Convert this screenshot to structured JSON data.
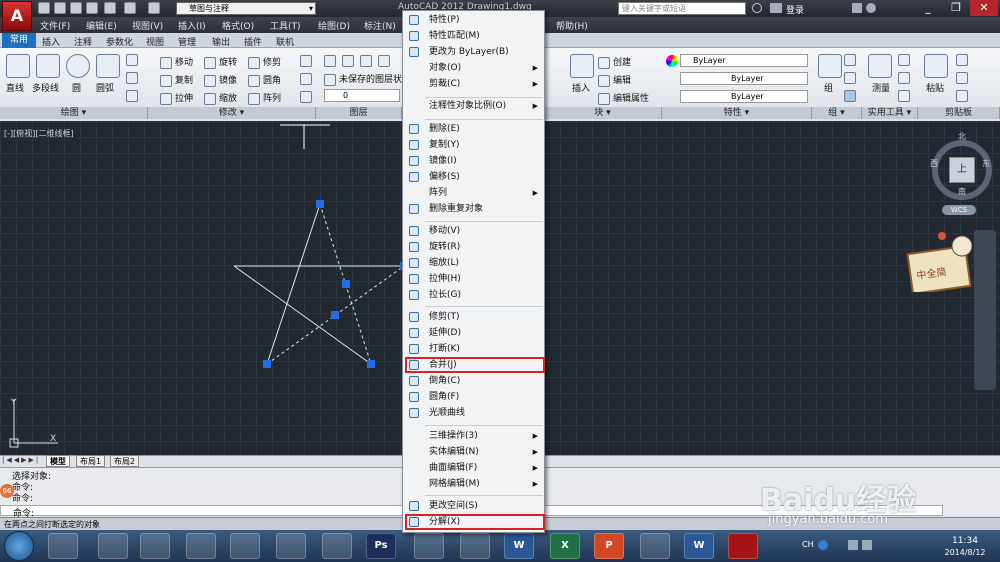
{
  "titlebar": {
    "workspace": "草图与注释",
    "app_title": "AutoCAD 2012    Drawing1.dwg",
    "search_placeholder": "键入关键字或短语",
    "login": "登录",
    "logo_letter": "A"
  },
  "menubar": [
    "文件(F)",
    "编辑(E)",
    "视图(V)",
    "插入(I)",
    "格式(O)",
    "工具(T)",
    "绘图(D)",
    "标注(N)",
    "帮助(H)"
  ],
  "ribbon_tabs": [
    "常用",
    "插入",
    "注释",
    "参数化",
    "视图",
    "管理",
    "输出",
    "插件",
    "联机"
  ],
  "ribbon": {
    "draw": {
      "line": "直线",
      "polyline": "多段线",
      "circle": "圆",
      "arc": "圆弧",
      "title": "绘图 ▾"
    },
    "modify": {
      "move": "移动",
      "rotate": "旋转",
      "trim": "修剪",
      "copy": "复制",
      "mirror": "镜像",
      "fillet": "圆角",
      "stretch": "拉伸",
      "scale": "缩放",
      "array": "阵列",
      "title": "修改 ▾"
    },
    "layers": {
      "state": "未保存的图层状态",
      "layer_value": "0",
      "title": "图层"
    },
    "block": {
      "insert": "插入",
      "create": "创建",
      "edit": "编辑",
      "edit_attr": "编辑属性",
      "title": "块 ▾"
    },
    "properties": {
      "color": "ByLayer",
      "linetype": "ByLayer",
      "lineweight": "ByLayer",
      "title": "特性 ▾"
    },
    "group": {
      "label": "组",
      "title": "组 ▾"
    },
    "utilities": {
      "measure": "测量",
      "title": "实用工具 ▾"
    },
    "clipboard": {
      "paste": "粘贴",
      "title": "剪贴板"
    }
  },
  "viewport_label": "[-][俯视][二维线框]",
  "viewcube": {
    "top": "上",
    "north": "北",
    "south": "南",
    "east": "东",
    "west": "西",
    "wcs": "WCS"
  },
  "layout_tabs": [
    "模型",
    "布局1",
    "布局2"
  ],
  "command": {
    "lines": [
      "选择对象:",
      "命令:",
      "命令:"
    ],
    "prompt": "命令:",
    "badge": "66"
  },
  "status_text": "在两点之间打断选定的对象",
  "context_menu": {
    "items": [
      {
        "label": "特性(P)",
        "arrow": false
      },
      {
        "label": "特性匹配(M)",
        "arrow": false
      },
      {
        "label": "更改为 ByLayer(B)",
        "arrow": false
      },
      {
        "label": "对象(O)",
        "arrow": true
      },
      {
        "label": "剪裁(C)",
        "arrow": true
      },
      {
        "label": "注释性对象比例(O)",
        "arrow": true
      },
      {
        "label": "删除(E)",
        "arrow": false
      },
      {
        "label": "复制(Y)",
        "arrow": false
      },
      {
        "label": "镜像(I)",
        "arrow": false
      },
      {
        "label": "偏移(S)",
        "arrow": false
      },
      {
        "label": "阵列",
        "arrow": true
      },
      {
        "label": "删除重复对象",
        "arrow": false
      },
      {
        "label": "移动(V)",
        "arrow": false
      },
      {
        "label": "旋转(R)",
        "arrow": false
      },
      {
        "label": "缩放(L)",
        "arrow": false
      },
      {
        "label": "拉伸(H)",
        "arrow": false
      },
      {
        "label": "拉长(G)",
        "arrow": false
      },
      {
        "label": "修剪(T)",
        "arrow": false
      },
      {
        "label": "延伸(D)",
        "arrow": false
      },
      {
        "label": "打断(K)",
        "arrow": false
      },
      {
        "label": "合并(J)",
        "arrow": false
      },
      {
        "label": "倒角(C)",
        "arrow": false
      },
      {
        "label": "圆角(F)",
        "arrow": false
      },
      {
        "label": "光顺曲线",
        "arrow": false
      },
      {
        "label": "三维操作(3)",
        "arrow": true
      },
      {
        "label": "实体编辑(N)",
        "arrow": true
      },
      {
        "label": "曲面编辑(F)",
        "arrow": true
      },
      {
        "label": "网格编辑(M)",
        "arrow": true
      },
      {
        "label": "更改空间(S)",
        "arrow": false
      },
      {
        "label": "分解(X)",
        "arrow": false
      }
    ]
  },
  "sticker_text": "中全简",
  "taskbar": {
    "apps": [
      "Ps",
      "W",
      "X",
      "P",
      "W"
    ],
    "lang": "CH",
    "time": "11:34",
    "date": "2014/8/12"
  },
  "watermark": {
    "brand": "Baidu经验",
    "url": "jingyan.baidu.com"
  },
  "colors": {
    "canvas": "#212830",
    "highlight": "#d42424",
    "grip": "#1e6fe8",
    "accent": "#1f6fc0"
  }
}
